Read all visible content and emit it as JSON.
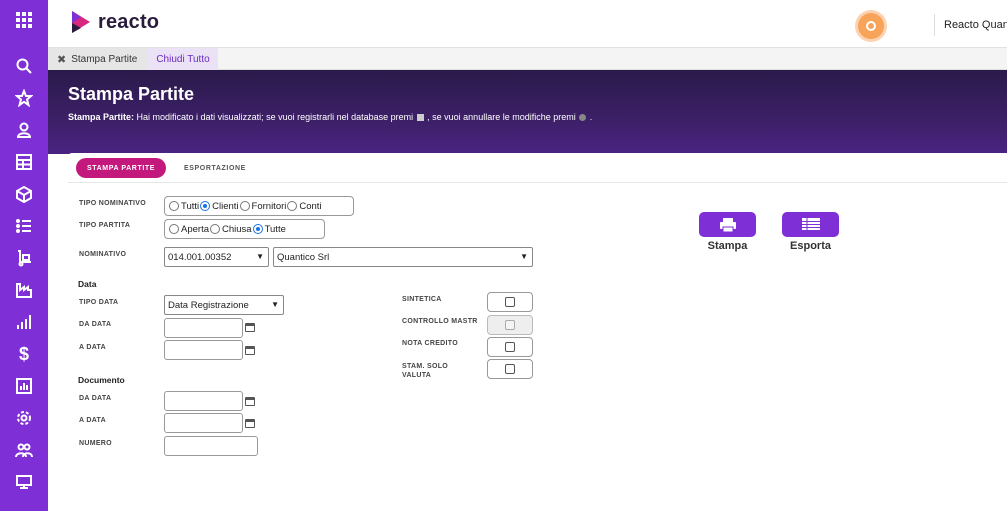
{
  "app": {
    "brand": "reacto",
    "user": "Reacto Quant"
  },
  "sidebar": {
    "items": [
      "grid-icon",
      "search-icon",
      "star-icon",
      "user-icon",
      "table-icon",
      "box-icon",
      "list-icon",
      "hand-truck-icon",
      "factory-icon",
      "bar-chart-icon",
      "dollar-icon",
      "chart-doc-icon",
      "gear-icon",
      "users-icon",
      "monitor-icon"
    ]
  },
  "tabs": {
    "open_tab": "Stampa Partite",
    "close_all": "Chiudi Tutto"
  },
  "banner": {
    "title": "Stampa Partite",
    "msg_bold": "Stampa Partite:",
    "msg_part1": " Hai modificato i dati visualizzati; se vuoi registrarli nel database premi ",
    "msg_part2": " , se vuoi annullare le modifiche premi ",
    "msg_end": " ."
  },
  "content_tabs": {
    "active": "STAMPA PARTITE",
    "other": "ESPORTAZIONE"
  },
  "form": {
    "tipo_nominativo": {
      "label": "TIPO NOMINATIVO",
      "options": [
        "Tutti",
        "Clienti",
        "Fornitori",
        "Conti"
      ],
      "selected": "Clienti"
    },
    "tipo_partita": {
      "label": "TIPO PARTITA",
      "options": [
        "Aperta",
        "Chiusa",
        "Tutte"
      ],
      "selected": "Tutte"
    },
    "nominativo": {
      "label": "NOMINATIVO",
      "code": "014.001.00352",
      "name": "Quantico Srl"
    },
    "data_section": "Data",
    "tipo_data": {
      "label": "TIPO DATA",
      "value": "Data Registrazione"
    },
    "da_data": {
      "label": "DA DATA",
      "value": ""
    },
    "a_data": {
      "label": "A DATA",
      "value": ""
    },
    "documento_section": "Documento",
    "doc_da_data": {
      "label": "DA DATA",
      "value": ""
    },
    "doc_a_data": {
      "label": "A DATA",
      "value": ""
    },
    "numero": {
      "label": "NUMERO",
      "value": ""
    },
    "sintetica": {
      "label": "SINTETICA",
      "checked": false
    },
    "controllo_mastri": {
      "label": "CONTROLLO MASTR",
      "checked": false,
      "disabled": true
    },
    "nota_credito": {
      "label": "NOTA CREDITO",
      "checked": false
    },
    "stam_solo_valuta": {
      "label_line1": "STAM. SOLO",
      "label_line2": "VALUTA",
      "checked": false
    }
  },
  "actions": {
    "stampa": "Stampa",
    "esporta": "Esporta"
  },
  "colors": {
    "sidebar": "#7e2fd6",
    "accent_tab": "#c4197c",
    "banner": "#3d2068",
    "button": "#7e2fd6"
  }
}
